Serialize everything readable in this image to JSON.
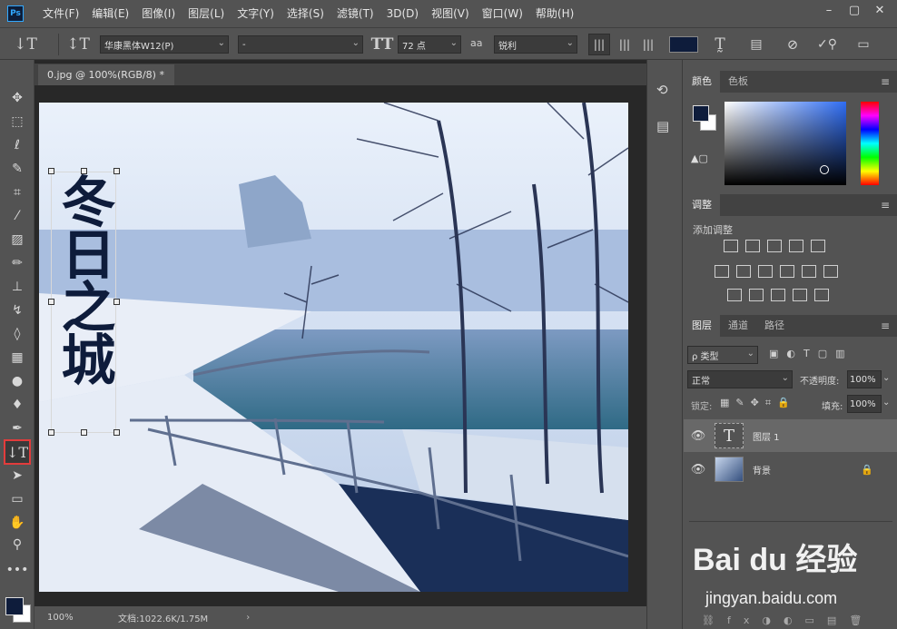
{
  "app": {
    "logo_text": "Ps"
  },
  "menu": [
    "文件(F)",
    "编辑(E)",
    "图像(I)",
    "图层(L)",
    "文字(Y)",
    "选择(S)",
    "滤镜(T)",
    "3D(D)",
    "视图(V)",
    "窗口(W)",
    "帮助(H)"
  ],
  "window_controls": {
    "minimize": "–",
    "restore": "▢",
    "close": "✕"
  },
  "options": {
    "font_family": "华康黑体W12(P)",
    "font_style": "-",
    "font_size": "72 点",
    "aa_label": "aa",
    "antialias": "锐利",
    "text_color": "#0e1c3b"
  },
  "document": {
    "tab_title": "0.jpg @ 100%(RGB/8) *",
    "overlay_text": "冬日之城",
    "text_color": "#0e1c3b"
  },
  "status": {
    "zoom": "100%",
    "doc_info": "文档:1022.6K/1.75M"
  },
  "color_panel": {
    "tabs": [
      "颜色",
      "色板"
    ],
    "foreground": "#0e1c3b",
    "background": "#ffffff"
  },
  "adjust_panel": {
    "tab": "调整",
    "subtitle": "添加调整"
  },
  "layers_panel": {
    "tabs": [
      "图层",
      "通道",
      "路径"
    ],
    "filter_kind": "ρ 类型",
    "blend_mode": "正常",
    "opacity_label": "不透明度:",
    "opacity_value": "100%",
    "lock_label": "锁定:",
    "fill_label": "填充:",
    "fill_value": "100%",
    "layers": [
      {
        "name": "图层 1",
        "kind": "text",
        "thumb": "T"
      },
      {
        "name": "背景",
        "kind": "image"
      }
    ]
  },
  "watermark": {
    "logo": "Bai du 经验",
    "url": "jingyan.baidu.com"
  }
}
